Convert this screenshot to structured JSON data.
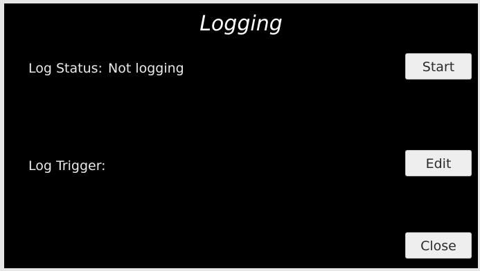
{
  "window": {
    "title": "Logging"
  },
  "log_status": {
    "label": "Log Status:",
    "value": "Not logging",
    "button_label": "Start"
  },
  "log_trigger": {
    "label": "Log Trigger:",
    "button_label": "Edit"
  },
  "footer": {
    "close_label": "Close"
  },
  "colors": {
    "background": "#000000",
    "text": "#e9e9e9",
    "button_bg": "#eeeeee",
    "button_text": "#2b2b2b"
  }
}
